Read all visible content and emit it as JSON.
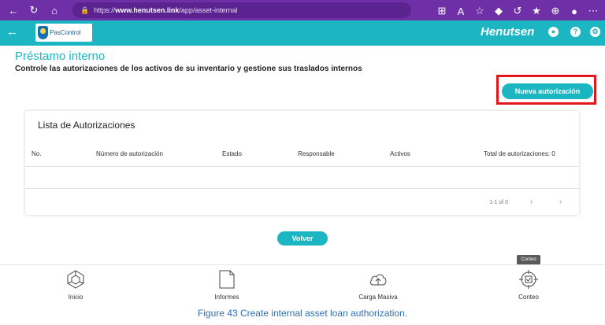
{
  "browser": {
    "url_prefix": "https://",
    "url_domain": "www.henutsen.link",
    "url_path": "/app/asset-internal"
  },
  "app": {
    "logo_text": "PasControl",
    "brand_name": "Henutsen",
    "accent_color": "#1bb6c1",
    "highlight_color": "#e3161b"
  },
  "page": {
    "title": "Préstamo interno",
    "subtitle": "Controle las autorizaciones de los activos de su inventario y gestione sus traslados internos",
    "new_button": "Nueva autorización",
    "back_button": "Volver"
  },
  "table": {
    "title": "Lista de Autorizaciones",
    "headers": [
      "No.",
      "Número de autorización",
      "Estado",
      "Responsable",
      "Activos",
      "Total de autorizaciones: 0"
    ],
    "pagination": "1-1 of 0"
  },
  "bottom_nav": {
    "items": [
      {
        "label": "Inicio",
        "icon": "home-grid-icon"
      },
      {
        "label": "Informes",
        "icon": "document-icon"
      },
      {
        "label": "Carga Masiva",
        "icon": "cloud-upload-icon"
      },
      {
        "label": "Conteo",
        "icon": "target-icon"
      }
    ],
    "tooltip": "Conteo"
  },
  "caption": "Figure 43 Create internal asset loan authorization."
}
